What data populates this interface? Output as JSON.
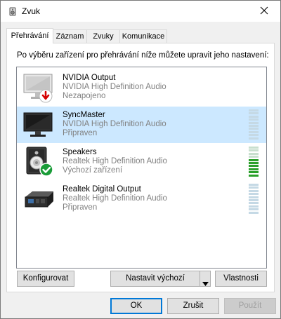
{
  "window": {
    "title": "Zvuk"
  },
  "tabs": [
    {
      "label": "Přehrávání"
    },
    {
      "label": "Záznam"
    },
    {
      "label": "Zvuky"
    },
    {
      "label": "Komunikace"
    }
  ],
  "instruction": "Po výběru zařízení pro přehrávání níže můžete upravit jeho nastavení:",
  "devices": [
    {
      "name": "NVIDIA Output",
      "driver": "NVIDIA High Definition Audio",
      "status": "Nezapojeno",
      "icon": "monitor-disconnected-icon",
      "level": 0
    },
    {
      "name": "SyncMaster",
      "driver": "NVIDIA High Definition Audio",
      "status": "Připraven",
      "icon": "monitor-icon",
      "level": 0
    },
    {
      "name": "Speakers",
      "driver": "Realtek High Definition Audio",
      "status": "Výchozí zařízení",
      "icon": "speaker-default-icon",
      "level": 0.6
    },
    {
      "name": "Realtek Digital Output",
      "driver": "Realtek High Definition Audio",
      "status": "Připraven",
      "icon": "digital-output-icon",
      "level": 0
    }
  ],
  "buttons": {
    "configure": "Konfigurovat",
    "set_default": "Nastavit výchozí",
    "properties": "Vlastnosti",
    "ok": "OK",
    "cancel": "Zrušit",
    "apply": "Použít"
  },
  "colors": {
    "selection": "#cce8ff",
    "meter_lit": "#2aa02a",
    "accent": "#0078d7"
  }
}
